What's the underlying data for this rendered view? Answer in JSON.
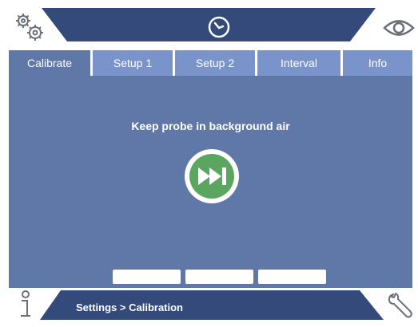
{
  "colors": {
    "navy": "#344a7a",
    "panel": "#5f78a8",
    "tab_inactive": "#7a93c8",
    "icon_gray": "#6a6f78",
    "accent_green": "#5aa661"
  },
  "top_bar": {
    "left_icon": "gears-icon",
    "center_icon": "gauge-icon",
    "right_icon": "eye-icon"
  },
  "tabs": [
    {
      "label": "Calibrate",
      "active": true
    },
    {
      "label": "Setup 1",
      "active": false
    },
    {
      "label": "Setup 2",
      "active": false
    },
    {
      "label": "Interval",
      "active": false
    },
    {
      "label": "Info",
      "active": false
    }
  ],
  "main": {
    "instruction": "Keep probe in background air",
    "skip_icon": "skip-forward-icon",
    "soft_buttons": [
      "",
      "",
      ""
    ]
  },
  "bottom_bar": {
    "left_icon": "info-icon",
    "breadcrumb": "Settings > Calibration",
    "right_icon": "wrench-icon"
  }
}
